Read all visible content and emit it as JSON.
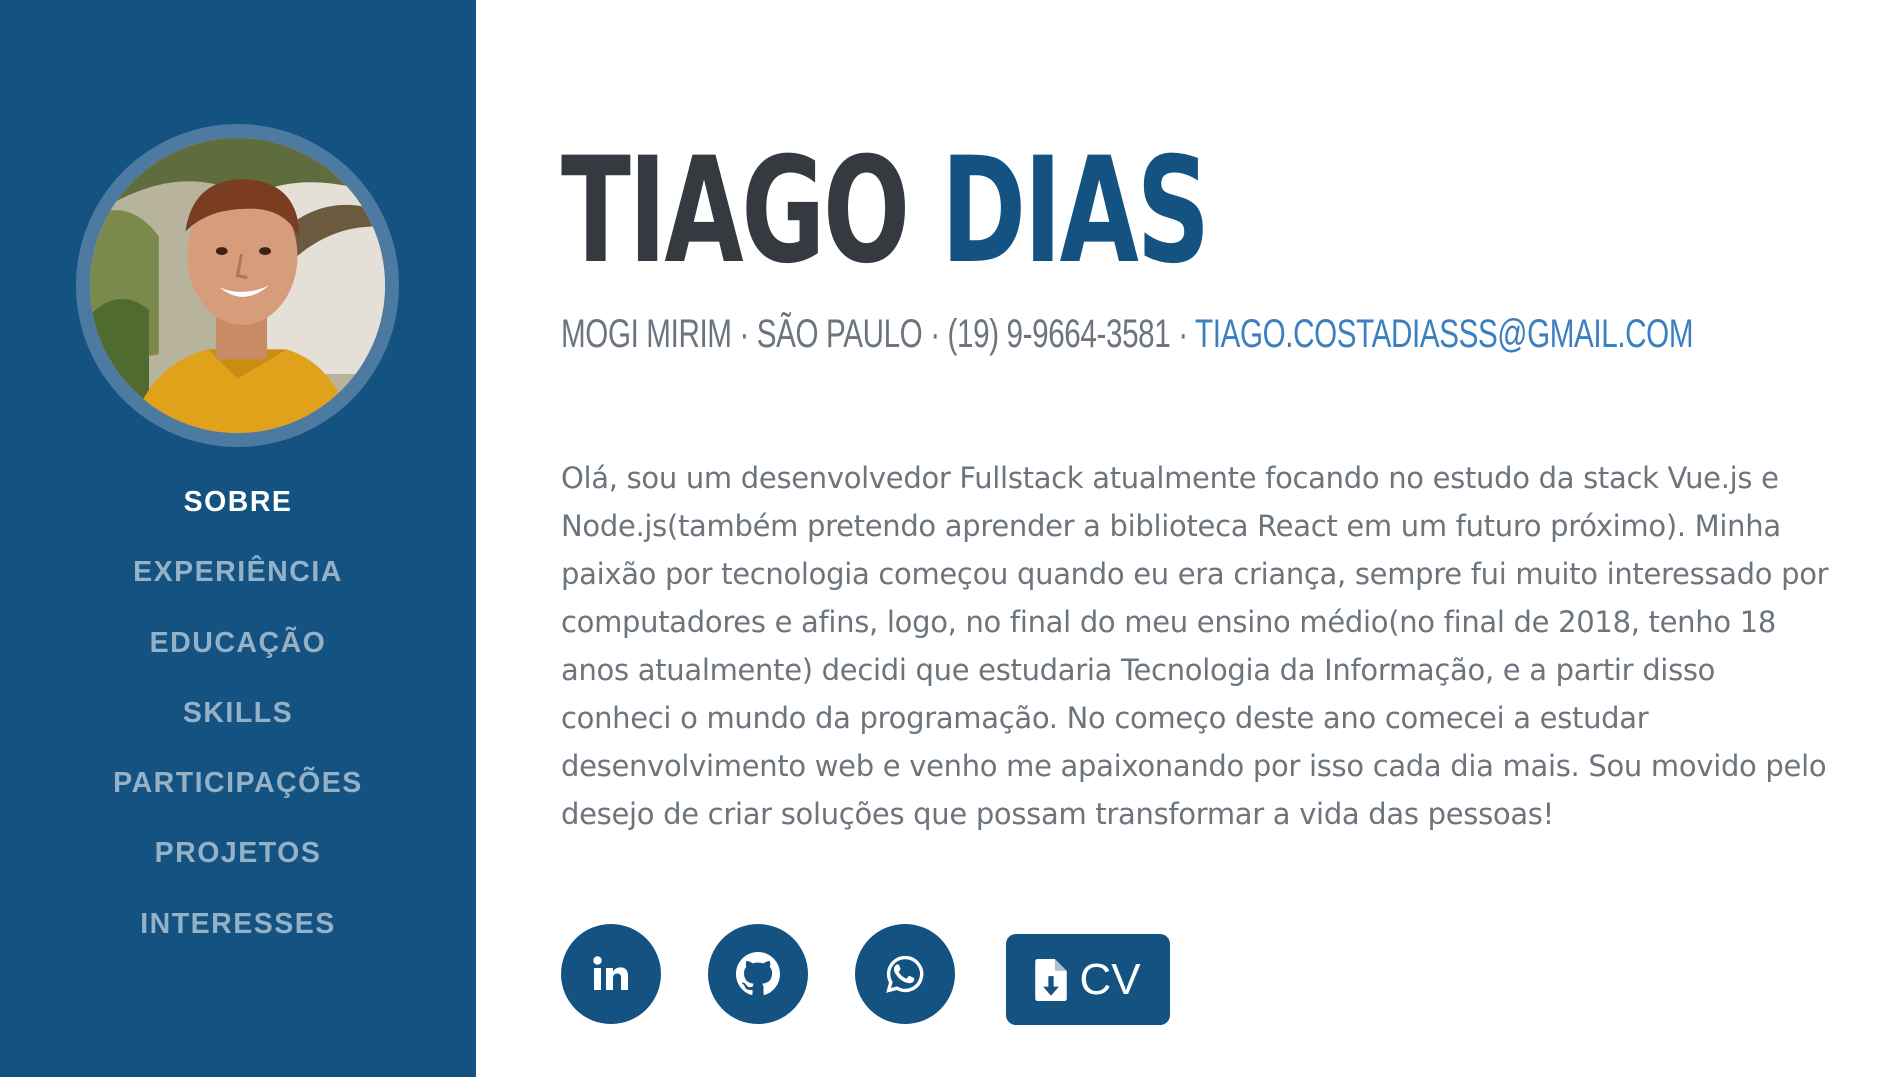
{
  "profile": {
    "first_name": "TIAGO",
    "last_name": "DIAS",
    "location": "MOGI MIRIM · SÃO PAULO · (19) 9-9664-3581 ·",
    "email": "TIAGO.COSTADIASSS@GMAIL.COM",
    "about": "Olá, sou um desenvolvedor Fullstack atualmente focando no estudo da stack Vue.js e Node.js(também pretendo aprender a biblioteca React em um futuro próximo). Minha paixão por tecnologia começou quando eu era criança, sempre fui muito interessado por computadores e afins, logo, no final do meu ensino médio(no final de 2018, tenho 18 anos atualmente) decidi que estudaria Tecnologia da Informação, e a partir disso conheci o mundo da programação. No começo deste ano comecei a estudar desenvolvimento web e venho me apaixonando por isso cada dia mais. Sou movido pelo desejo de criar soluções que possam transformar a vida das pessoas!"
  },
  "sidebar": {
    "items": [
      {
        "label": "SOBRE",
        "active": true
      },
      {
        "label": "EXPERIÊNCIA",
        "active": false
      },
      {
        "label": "EDUCAÇÃO",
        "active": false
      },
      {
        "label": "SKILLS",
        "active": false
      },
      {
        "label": "PARTICIPAÇÕES",
        "active": false
      },
      {
        "label": "PROJETOS",
        "active": false
      },
      {
        "label": "INTERESSES",
        "active": false
      }
    ]
  },
  "social": {
    "buttons": [
      {
        "icon": "linkedin-icon"
      },
      {
        "icon": "github-icon"
      },
      {
        "icon": "whatsapp-icon"
      }
    ],
    "cv_label": "CV",
    "cv_icon": "file-download-icon"
  },
  "colors": {
    "primary": "#145282",
    "avatar_ring": "#4d7aa0",
    "heading": "#343a40",
    "text": "#6c757d",
    "link": "#3a7fc0"
  }
}
